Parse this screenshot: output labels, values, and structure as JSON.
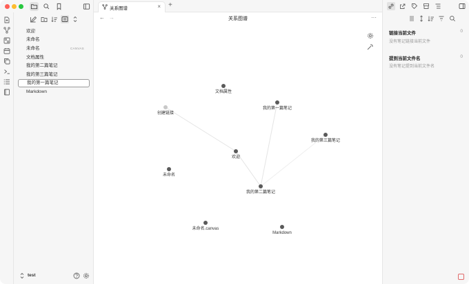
{
  "tab": {
    "label": "关系图谱"
  },
  "view": {
    "title": "关系图谱"
  },
  "files": [
    {
      "name": "欢迎",
      "badge": ""
    },
    {
      "name": "未命名",
      "badge": ""
    },
    {
      "name": "未命名",
      "badge": "CANVAS"
    },
    {
      "name": "文档属性",
      "badge": ""
    },
    {
      "name": "我的第二篇笔记",
      "badge": ""
    },
    {
      "name": "我的第三篇笔记",
      "badge": ""
    },
    {
      "name": "我的第一篇笔记",
      "badge": ""
    },
    {
      "name": "Markdown",
      "badge": ""
    }
  ],
  "vault": {
    "name": "test"
  },
  "graph": {
    "nodes": [
      {
        "label": "文档属性"
      },
      {
        "label": "我的第一篇笔记"
      },
      {
        "label": "创建链接"
      },
      {
        "label": "我的第三篇笔记"
      },
      {
        "label": "欢迎"
      },
      {
        "label": "未命名"
      },
      {
        "label": "我的第二篇笔记"
      },
      {
        "label": "未命名.canvas"
      },
      {
        "label": "Markdown"
      }
    ]
  },
  "right_panel": {
    "links": {
      "title": "链接当前文件",
      "count": "0",
      "empty": "没有笔记链接当前文件"
    },
    "mentions": {
      "title": "提到当前文件名",
      "count": "0",
      "empty": "没有笔记提到当前文件名"
    }
  },
  "colors": {
    "node": "#5a5a5a",
    "node_unresolved": "#c8c8c8",
    "edge": "#e4e4e4",
    "close": "#ff5f57",
    "minimize": "#febc2e",
    "maximize": "#28c840"
  },
  "icons": {
    "ribbon": [
      "file-plus-icon",
      "graph-icon",
      "canvas-icon",
      "calendar-icon",
      "copy-icon",
      "terminal-icon",
      "list-icon",
      "book-icon"
    ],
    "nav": [
      "new-note-icon",
      "new-folder-icon",
      "sort-icon",
      "collapse-icon",
      "expand-icon"
    ],
    "right": [
      "link-icon",
      "outgoing-link-icon",
      "tag-icon",
      "bookmark-icon",
      "outline-icon"
    ]
  },
  "editor_menu": "···"
}
